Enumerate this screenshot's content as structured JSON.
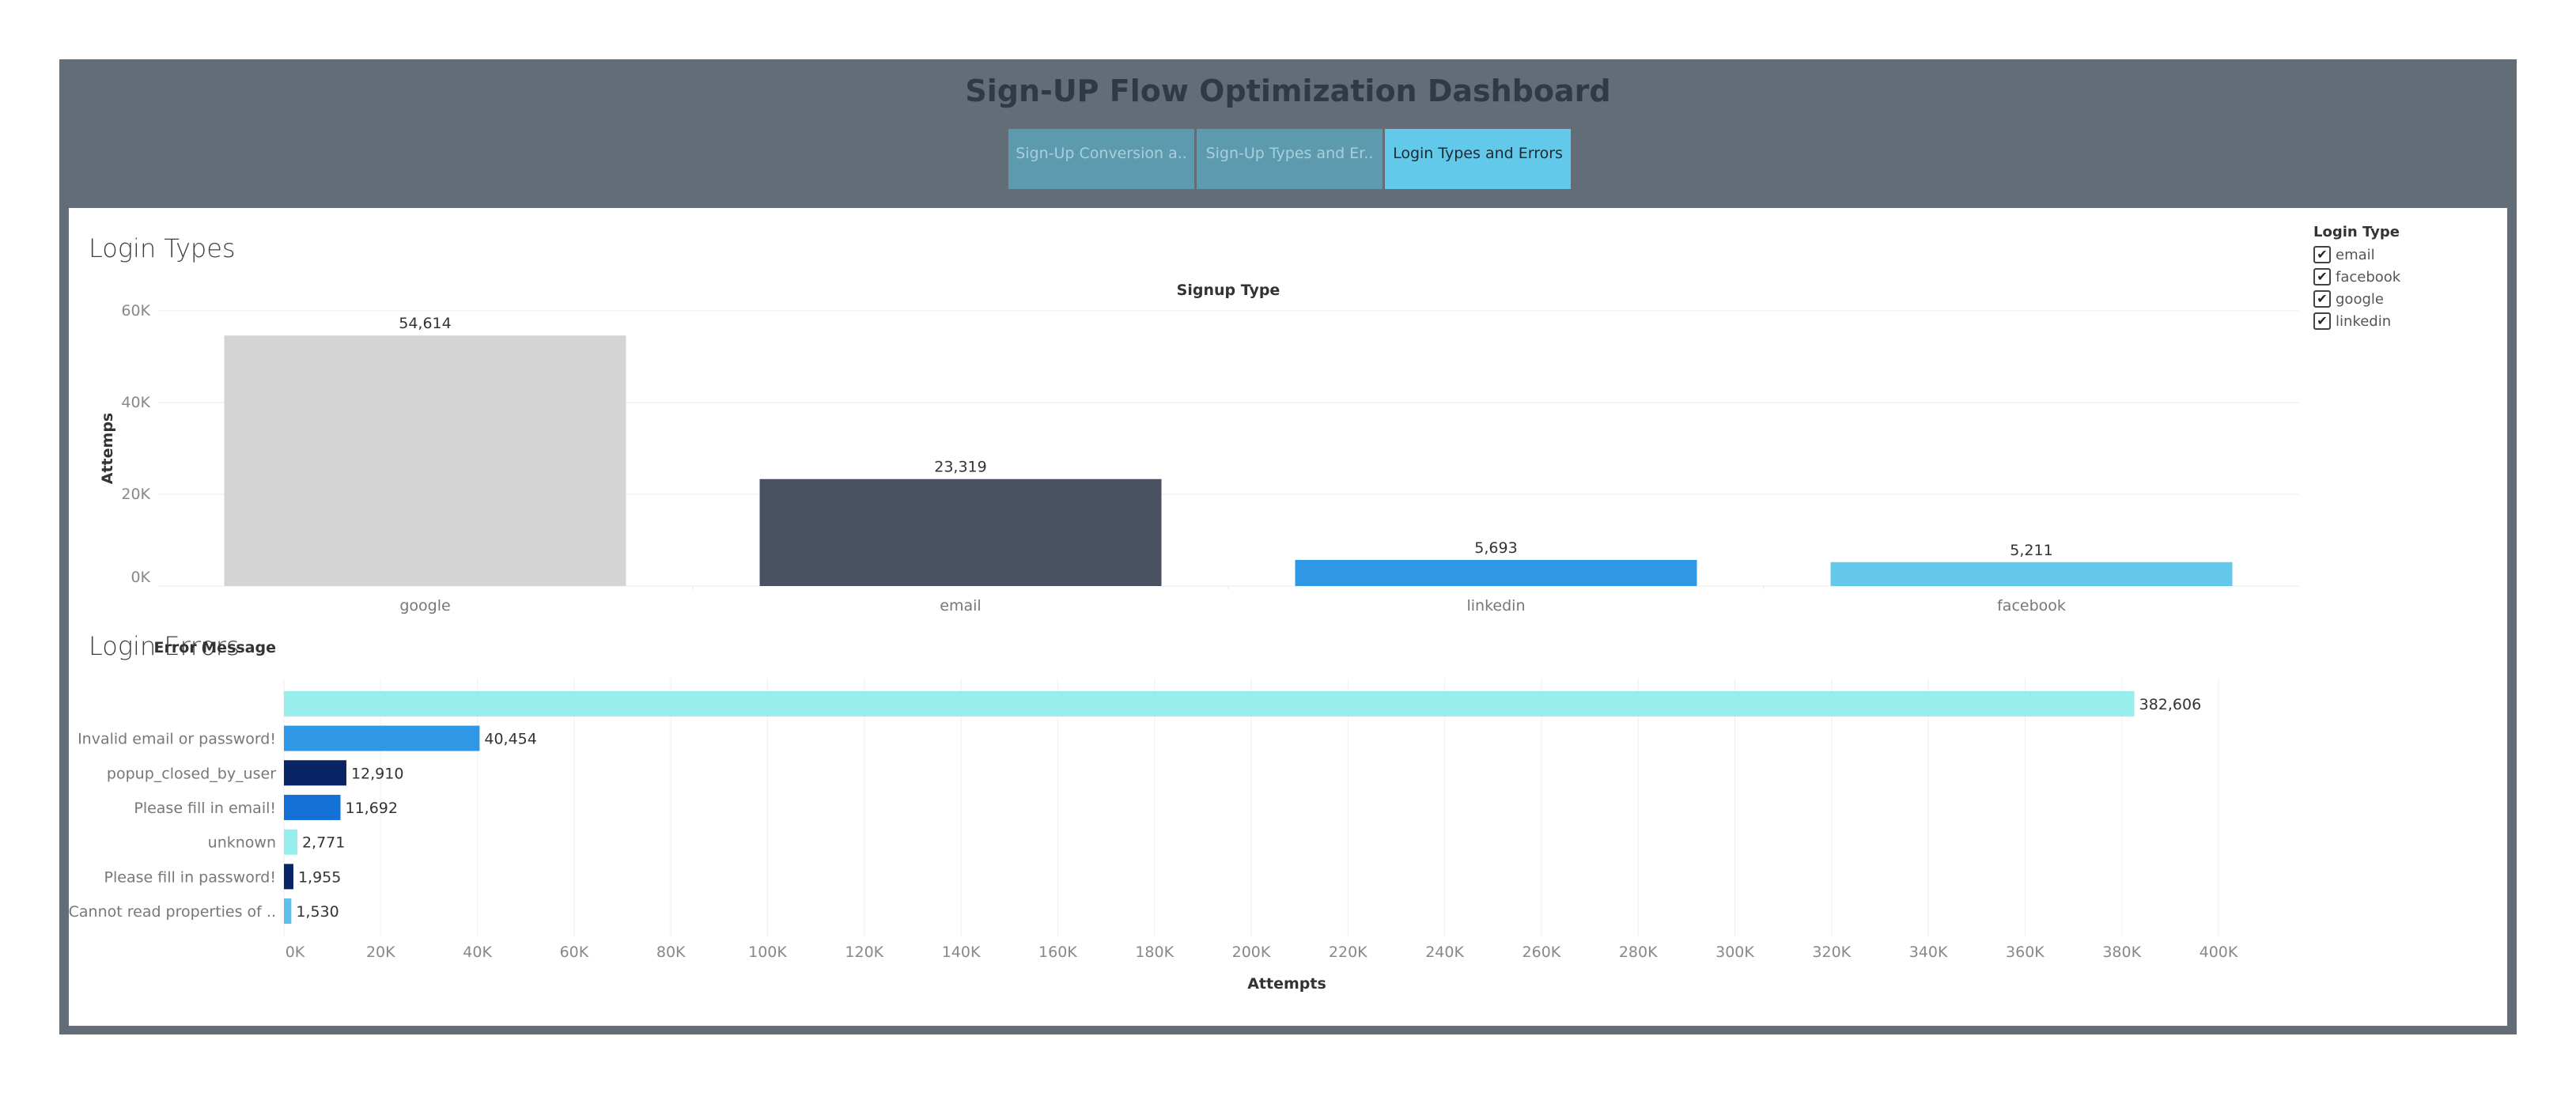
{
  "dashboard": {
    "title": "Sign-UP Flow Optimization Dashboard",
    "tabs": [
      {
        "label": "Sign-Up Conversion a..",
        "active": false
      },
      {
        "label": "Sign-Up Types and Er..",
        "active": false
      },
      {
        "label": "Login Types and Errors",
        "active": true
      }
    ]
  },
  "legend": {
    "title": "Login Type",
    "items": [
      {
        "label": "email",
        "checked": true
      },
      {
        "label": "facebook",
        "checked": true
      },
      {
        "label": "google",
        "checked": true
      },
      {
        "label": "linkedin",
        "checked": true
      }
    ]
  },
  "chart_data": [
    {
      "type": "bar",
      "orientation": "vertical",
      "title": "Login Types",
      "subtitle": "Signup Type",
      "ylabel": "Attemps",
      "categories": [
        "google",
        "email",
        "linkedin",
        "facebook"
      ],
      "values": [
        54614,
        23319,
        5693,
        5211
      ],
      "value_labels": [
        "54,614",
        "23,319",
        "5,693",
        "5,211"
      ],
      "colors": [
        "#d4d4d4",
        "#4a5261",
        "#2f98e6",
        "#63c8ea"
      ],
      "yticks": [
        "0K",
        "20K",
        "40K",
        "60K"
      ],
      "ylim": [
        0,
        60000
      ],
      "grid": true
    },
    {
      "type": "bar",
      "orientation": "horizontal",
      "title": "Login Errors",
      "category_header": "Error Message",
      "xlabel": "Attempts",
      "categories": [
        "",
        "Invalid email or password!",
        "popup_closed_by_user",
        "Please fill in email!",
        "unknown",
        "Please fill in password!",
        "Cannot read properties of .."
      ],
      "values": [
        382606,
        40454,
        12910,
        11692,
        2771,
        1955,
        1530
      ],
      "value_labels": [
        "382,606",
        "40,454",
        "12,910",
        "11,692",
        "2,771",
        "1,955",
        "1,530"
      ],
      "colors": [
        "#98eeed",
        "#2f98e6",
        "#0a2566",
        "#1370d4",
        "#98eeed",
        "#0a2566",
        "#5bc0ea"
      ],
      "xticks": [
        "0K",
        "20K",
        "40K",
        "60K",
        "80K",
        "100K",
        "120K",
        "140K",
        "160K",
        "180K",
        "200K",
        "220K",
        "240K",
        "260K",
        "280K",
        "300K",
        "320K",
        "340K",
        "360K",
        "380K",
        "400K"
      ],
      "xlim": [
        0,
        400000
      ],
      "grid": true
    }
  ]
}
